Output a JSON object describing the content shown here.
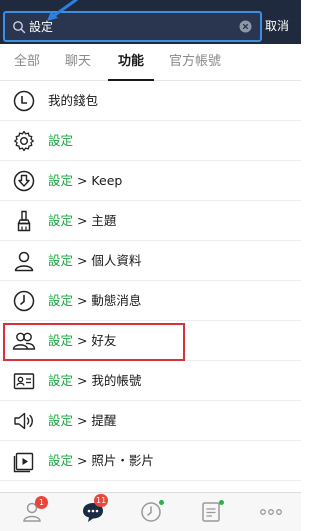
{
  "search": {
    "value": "設定",
    "cancel_label": "取消"
  },
  "tabs": [
    {
      "label": "全部"
    },
    {
      "label": "聊天"
    },
    {
      "label": "功能",
      "active": true
    },
    {
      "label": "官方帳號"
    }
  ],
  "items": [
    {
      "plain": "我的錢包",
      "green": "",
      "suffix": "",
      "icon": "wallet-icon"
    },
    {
      "plain": "",
      "green": "設定",
      "suffix": "",
      "icon": "gear-icon"
    },
    {
      "plain": "",
      "green": "設定",
      "suffix": " > Keep",
      "icon": "keep-icon"
    },
    {
      "plain": "",
      "green": "設定",
      "suffix": " > 主題",
      "icon": "brush-icon"
    },
    {
      "plain": "",
      "green": "設定",
      "suffix": " > 個人資料",
      "icon": "person-icon"
    },
    {
      "plain": "",
      "green": "設定",
      "suffix": " > 動態消息",
      "icon": "clock-icon"
    },
    {
      "plain": "",
      "green": "設定",
      "suffix": " > 好友",
      "icon": "friends-icon"
    },
    {
      "plain": "",
      "green": "設定",
      "suffix": " > 我的帳號",
      "icon": "id-card-icon"
    },
    {
      "plain": "",
      "green": "設定",
      "suffix": " > 提醒",
      "icon": "speaker-icon"
    },
    {
      "plain": "",
      "green": "設定",
      "suffix": " > 照片・影片",
      "icon": "photo-video-icon"
    }
  ],
  "bottom_nav": {
    "friends_badge": "1",
    "chats_badge": "11"
  },
  "colors": {
    "accent_green": "#19a93f",
    "highlight_red": "#d9303a",
    "topbar": "#1f2a3e"
  }
}
